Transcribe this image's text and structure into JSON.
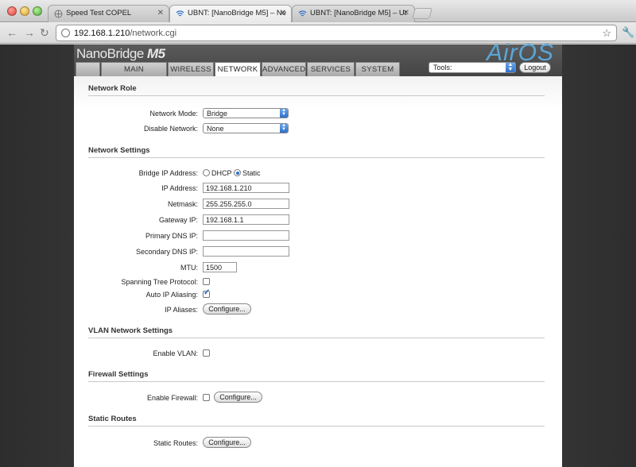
{
  "browser": {
    "tabs": [
      {
        "label": "Speed Test COPEL",
        "active": false
      },
      {
        "label": "UBNT: [NanoBridge M5] – Ne",
        "active": true
      },
      {
        "label": "UBNT: [NanoBridge M5] – Ut",
        "active": false
      }
    ],
    "url_host": "192.168.1.210",
    "url_path": "/network.cgi"
  },
  "header": {
    "logo_text": "NanoBridge",
    "logo_model": "M5",
    "brand": "AirOS",
    "brand_color": "#5aa6d8"
  },
  "nav": {
    "tabs": [
      "MAIN",
      "WIRELESS",
      "NETWORK",
      "ADVANCED",
      "SERVICES",
      "SYSTEM"
    ],
    "active": "NETWORK"
  },
  "tools": {
    "label": "Tools:",
    "logout": "Logout"
  },
  "network_role": {
    "title": "Network Role",
    "mode_label": "Network Mode:",
    "mode_value": "Bridge",
    "disable_label": "Disable Network:",
    "disable_value": "None"
  },
  "network_settings": {
    "title": "Network Settings",
    "bridge_ip_label": "Bridge IP Address:",
    "dhcp_label": "DHCP",
    "static_label": "Static",
    "bridge_ip_mode": "Static",
    "ip_label": "IP Address:",
    "ip_value": "192.168.1.210",
    "netmask_label": "Netmask:",
    "netmask_value": "255.255.255.0",
    "gateway_label": "Gateway IP:",
    "gateway_value": "192.168.1.1",
    "dns1_label": "Primary DNS IP:",
    "dns1_value": "",
    "dns2_label": "Secondary DNS IP:",
    "dns2_value": "",
    "mtu_label": "MTU:",
    "mtu_value": "1500",
    "stp_label": "Spanning Tree Protocol:",
    "stp_checked": false,
    "alias_label": "Auto IP Aliasing:",
    "alias_checked": true,
    "ip_aliases_label": "IP Aliases:",
    "configure": "Configure..."
  },
  "vlan": {
    "title": "VLAN Network Settings",
    "enable_label": "Enable VLAN:",
    "enabled": false
  },
  "firewall": {
    "title": "Firewall Settings",
    "enable_label": "Enable Firewall:",
    "enabled": false,
    "configure": "Configure..."
  },
  "routes": {
    "title": "Static Routes",
    "label": "Static Routes:",
    "configure": "Configure..."
  }
}
